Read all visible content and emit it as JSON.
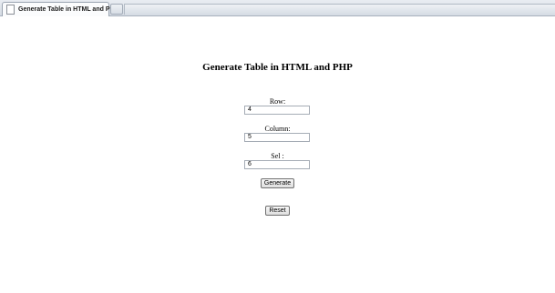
{
  "browser": {
    "tab_title": "Generate Table in HTML and PHP"
  },
  "page": {
    "heading": "Generate Table in HTML and PHP",
    "fields": {
      "row_label": "Row:",
      "row_value": "4",
      "column_label": "Column:",
      "column_value": "5",
      "sel_label": "Sel :",
      "sel_value": "6"
    },
    "generate_label": "Generate",
    "reset_label": "Reset"
  }
}
